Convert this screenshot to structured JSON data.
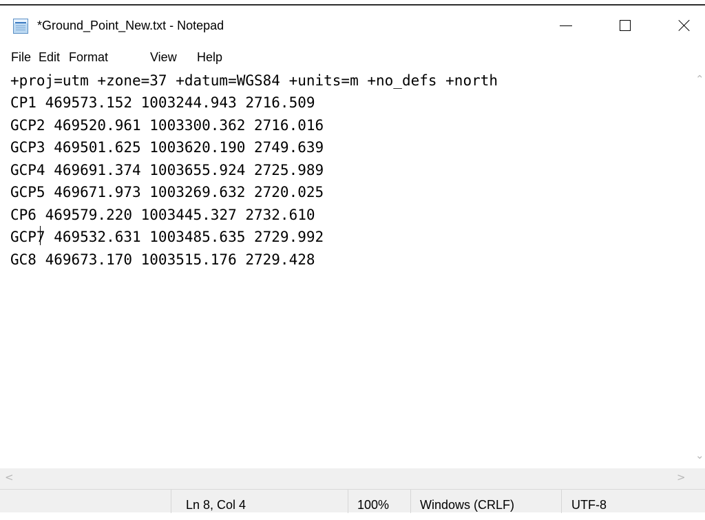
{
  "window": {
    "title": "*Ground_Point_New.txt - Notepad",
    "icon": "notepad-icon"
  },
  "menu": [
    "File",
    "Edit",
    "Format",
    "View",
    "Help"
  ],
  "editor": {
    "lines": [
      "+proj=utm +zone=37 +datum=WGS84 +units=m +no_defs +north",
      "CP1 469573.152 1003244.943 2716.509",
      "GCP2 469520.961 1003300.362 2716.016",
      "GCP3 469501.625 1003620.190 2749.639",
      "GCP4 469691.374 1003655.924 2725.989",
      "GCP5 469671.973 1003269.632 2720.025",
      "CP6 469579.220 1003445.327 2732.610",
      "GCP7 469532.631 1003485.635 2729.992",
      "GC8 469673.170 1003515.176 2729.428"
    ]
  },
  "status": {
    "cursor": "Ln 8, Col 4",
    "zoom": "100%",
    "line_endings": "Windows (CRLF)",
    "encoding": "UTF-8"
  },
  "colors": {
    "chrome": "#f0f0f0",
    "text": "#000000",
    "window": "#ffffff"
  }
}
